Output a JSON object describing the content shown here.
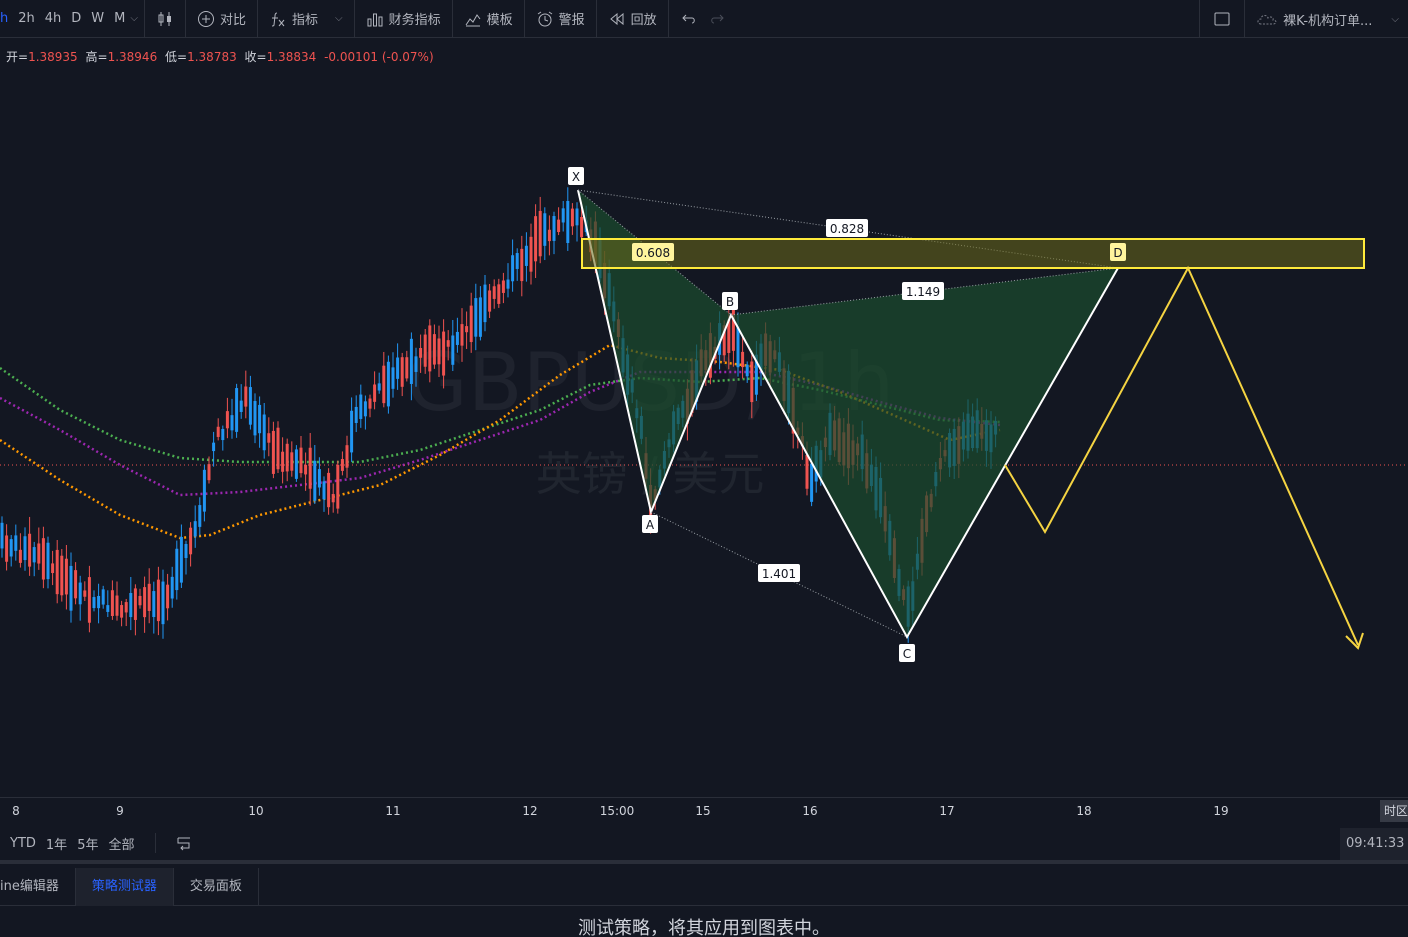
{
  "toolbar": {
    "timeframes": [
      "h",
      "2h",
      "4h",
      "D",
      "W",
      "M"
    ],
    "active_timeframe": "h",
    "compare_label": "对比",
    "indicators_label": "指标",
    "financials_label": "财务指标",
    "templates_label": "模板",
    "alerts_label": "警报",
    "replay_label": "回放",
    "layout_name": "裸K-机构订单..."
  },
  "ohlc": {
    "open_label": "开=",
    "open": "1.38935",
    "high_label": "高=",
    "high": "1.38946",
    "low_label": "低=",
    "low": "1.38783",
    "close_label": "收=",
    "close": "1.38834",
    "change": "-0.00101 (-0.07%)"
  },
  "watermark": {
    "symbol": "GBPUSD, 1h",
    "name": "英镑 / 美元"
  },
  "pattern": {
    "points": [
      "X",
      "A",
      "B",
      "C",
      "D"
    ],
    "ratios": [
      "0.608",
      "1.401",
      "1.149",
      "0.828"
    ]
  },
  "time_axis": {
    "ticks": [
      "8",
      "9",
      "10",
      "11",
      "12",
      "15:00",
      "15",
      "16",
      "17",
      "18",
      "19"
    ],
    "timezone_label": "时区"
  },
  "range_bar": {
    "items": [
      "YTD",
      "1年",
      "5年",
      "全部"
    ]
  },
  "clock": "09:41:33 (",
  "bottom_tabs": [
    "ine编辑器",
    "策略测试器",
    "交易面板"
  ],
  "active_bottom_tab": "策略测试器",
  "panel_message": "测试策略，将其应用到图表中。",
  "colors": {
    "background": "#131722",
    "up": "#2196f3",
    "down": "#ef5350",
    "ma_green": "#4caf50",
    "ma_purple": "#9c27b0",
    "ma_orange": "#ff9800",
    "pattern_fill": "#1b4d2e",
    "zone_stroke": "#ffeb3b",
    "projection": "#f5d442"
  }
}
